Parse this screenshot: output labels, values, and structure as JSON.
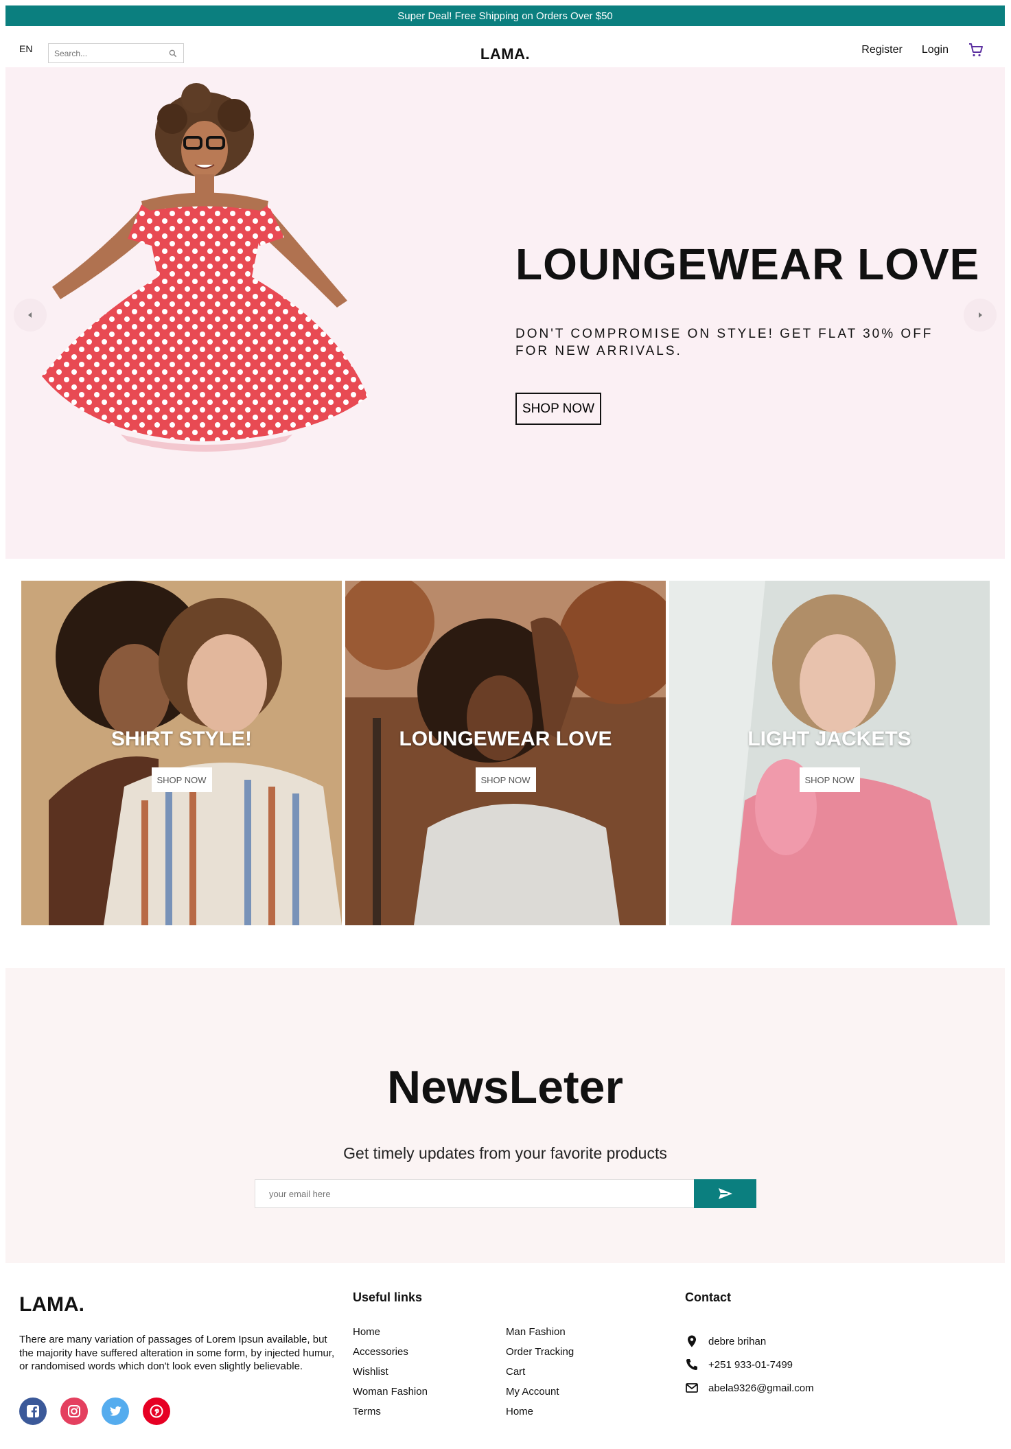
{
  "announcement": "Super Deal! Free Shipping on Orders Over $50",
  "nav": {
    "language": "EN",
    "search_placeholder": "Search...",
    "logo": "LAMA.",
    "register": "Register",
    "login": "Login"
  },
  "hero": {
    "title": "LOUNGEWEAR LOVE",
    "description": "DON'T COMPROMISE ON STYLE! GET FLAT 30% OFF FOR NEW ARRIVALS.",
    "button": "SHOP NOW"
  },
  "categories": [
    {
      "title": "SHIRT STYLE!",
      "button": "SHOP NOW"
    },
    {
      "title": "LOUNGEWEAR LOVE",
      "button": "SHOP NOW"
    },
    {
      "title": "LIGHT JACKETS",
      "button": "SHOP NOW"
    }
  ],
  "newsletter": {
    "title": "NewsLeter",
    "subtitle": "Get timely updates from your favorite products",
    "placeholder": "your email here"
  },
  "footer": {
    "logo": "LAMA.",
    "description": "There are many variation of passages of Lorem Ipsun available, but the majority have suffered alteration in some form, by injected humur, or randomised words which don't look even slightly believable.",
    "useful_links_title": "Useful links",
    "links_col1": [
      "Home",
      "Accessories",
      "Wishlist",
      "Woman Fashion",
      "Terms"
    ],
    "links_col2": [
      "Man Fashion",
      "Order Tracking",
      "Cart",
      "My Account",
      "Home"
    ],
    "contact_title": "Contact",
    "address": "debre brihan",
    "phone": "+251 933-01-7499",
    "email": "abela9326@gmail.com"
  },
  "colors": {
    "accent": "#0b7f7f",
    "hero_bg": "#fbf0f4",
    "newsletter_bg": "#fbf4f4",
    "facebook": "#3b5999",
    "instagram": "#e4405f",
    "twitter": "#55acee",
    "pinterest": "#e60023",
    "cart_icon": "#5b2fa0"
  }
}
